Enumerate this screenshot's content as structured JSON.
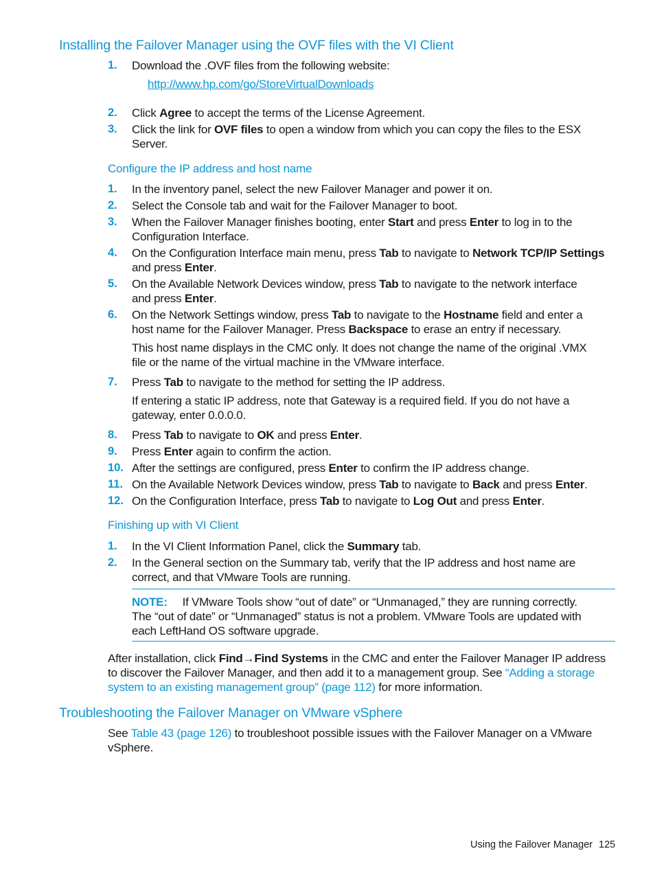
{
  "section1": {
    "title": "Installing the Failover Manager using the OVF files with the VI Client",
    "steps": [
      {
        "n": "1.",
        "pre": "Download the .OVF files from the following website:"
      },
      {
        "n": "2.",
        "a": "Click ",
        "b": "Agree",
        "c": " to accept the terms of the License Agreement."
      },
      {
        "n": "3.",
        "a": "Click the link for ",
        "b": "OVF files",
        "c": " to open a window from which you can copy the files to the ESX",
        "d": "Server."
      }
    ],
    "url": "http://www.hp.com/go/StoreVirtualDownloads"
  },
  "configure": {
    "title": "Configure the IP address and host name",
    "steps": [
      {
        "n": "1.",
        "text": "In the inventory panel, select the new Failover Manager and power it on."
      },
      {
        "n": "2.",
        "text": "Select the Console tab and wait for the Failover Manager to boot."
      },
      {
        "n": "3.",
        "a": "When the Failover Manager finishes booting, enter ",
        "b": "Start",
        "c": " and press ",
        "d": "Enter",
        "e": " to log in to the",
        "f": "Configuration Interface."
      },
      {
        "n": "4.",
        "a": "On the Configuration Interface main menu, press ",
        "b": "Tab",
        "c": " to navigate to ",
        "d": "Network TCP/IP Settings",
        "e": "and press ",
        "f": "Enter",
        "g": "."
      },
      {
        "n": "5.",
        "a": "On the Available Network Devices window, press ",
        "b": "Tab",
        "c": " to navigate to the network interface",
        "d": "and press ",
        "e": "Enter",
        "f": "."
      },
      {
        "n": "6.",
        "a": "On the Network Settings window, press ",
        "b": "Tab",
        "c": " to navigate to the ",
        "d": "Hostname",
        "e": " field and enter a",
        "f": "host name for the Failover Manager. Press ",
        "g": "Backspace",
        "h": " to erase an entry if necessary.",
        "note1": "This host name displays in the CMC only. It does not change the name of the original .VMX",
        "note2": "file or the name of the virtual machine in the VMware interface."
      },
      {
        "n": "7.",
        "a": "Press ",
        "b": "Tab",
        "c": " to navigate to the method for setting the IP address.",
        "note1": "If entering a static IP address, note that Gateway is a required field. If you do not have a",
        "note2": "gateway, enter 0.0.0.0."
      },
      {
        "n": "8.",
        "a": "Press ",
        "b": "Tab",
        "c": " to navigate to ",
        "d": "OK",
        "e": " and press ",
        "f": "Enter",
        "g": "."
      },
      {
        "n": "9.",
        "a": "Press ",
        "b": "Enter",
        "c": " again to confirm the action."
      },
      {
        "n": "10.",
        "a": "After the settings are configured, press ",
        "b": "Enter",
        "c": " to confirm the IP address change."
      },
      {
        "n": "11.",
        "a": "On the Available Network Devices window, press ",
        "b": "Tab",
        "c": " to navigate to ",
        "d": "Back",
        "e": " and press ",
        "f": "Enter",
        "g": "."
      },
      {
        "n": "12.",
        "a": "On the Configuration Interface, press ",
        "b": "Tab",
        "c": " to navigate to ",
        "d": "Log Out",
        "e": " and press ",
        "f": "Enter",
        "g": "."
      }
    ]
  },
  "finishing": {
    "title": "Finishing up with VI Client",
    "steps": [
      {
        "n": "1.",
        "a": "In the VI Client Information Panel, click the ",
        "b": "Summary",
        "c": " tab."
      },
      {
        "n": "2.",
        "a": "In the General section on the Summary tab, verify that the IP address and host name are",
        "b": "correct, and that VMware Tools are running."
      }
    ],
    "note": {
      "label": "NOTE:",
      "l1": "If VMware Tools show “out of date” or “Unmanaged,” they are running correctly.",
      "l2": "The “out of date” or “Unmanaged” status is not a problem. VMware Tools are updated with",
      "l3": "each LeftHand OS software upgrade."
    },
    "after": {
      "a": "After installation, click ",
      "b": "Find",
      "arrow": "→",
      "c": "Find Systems",
      "d": " in the CMC and enter the Failover Manager IP address",
      "e": "to discover the Failover Manager, and then add it to a management group. See ",
      "link1": "“Adding a storage",
      "link2": "system to an existing management group” (page 112)",
      "f": " for more information."
    }
  },
  "troubleshooting": {
    "title": "Troubleshooting the Failover Manager on VMware vSphere",
    "a": "See ",
    "link": "Table 43 (page 126)",
    "b": " to troubleshoot possible issues with the Failover Manager on a VMware",
    "c": "vSphere."
  },
  "footer": {
    "section": "Using the Failover Manager",
    "page": "125"
  }
}
